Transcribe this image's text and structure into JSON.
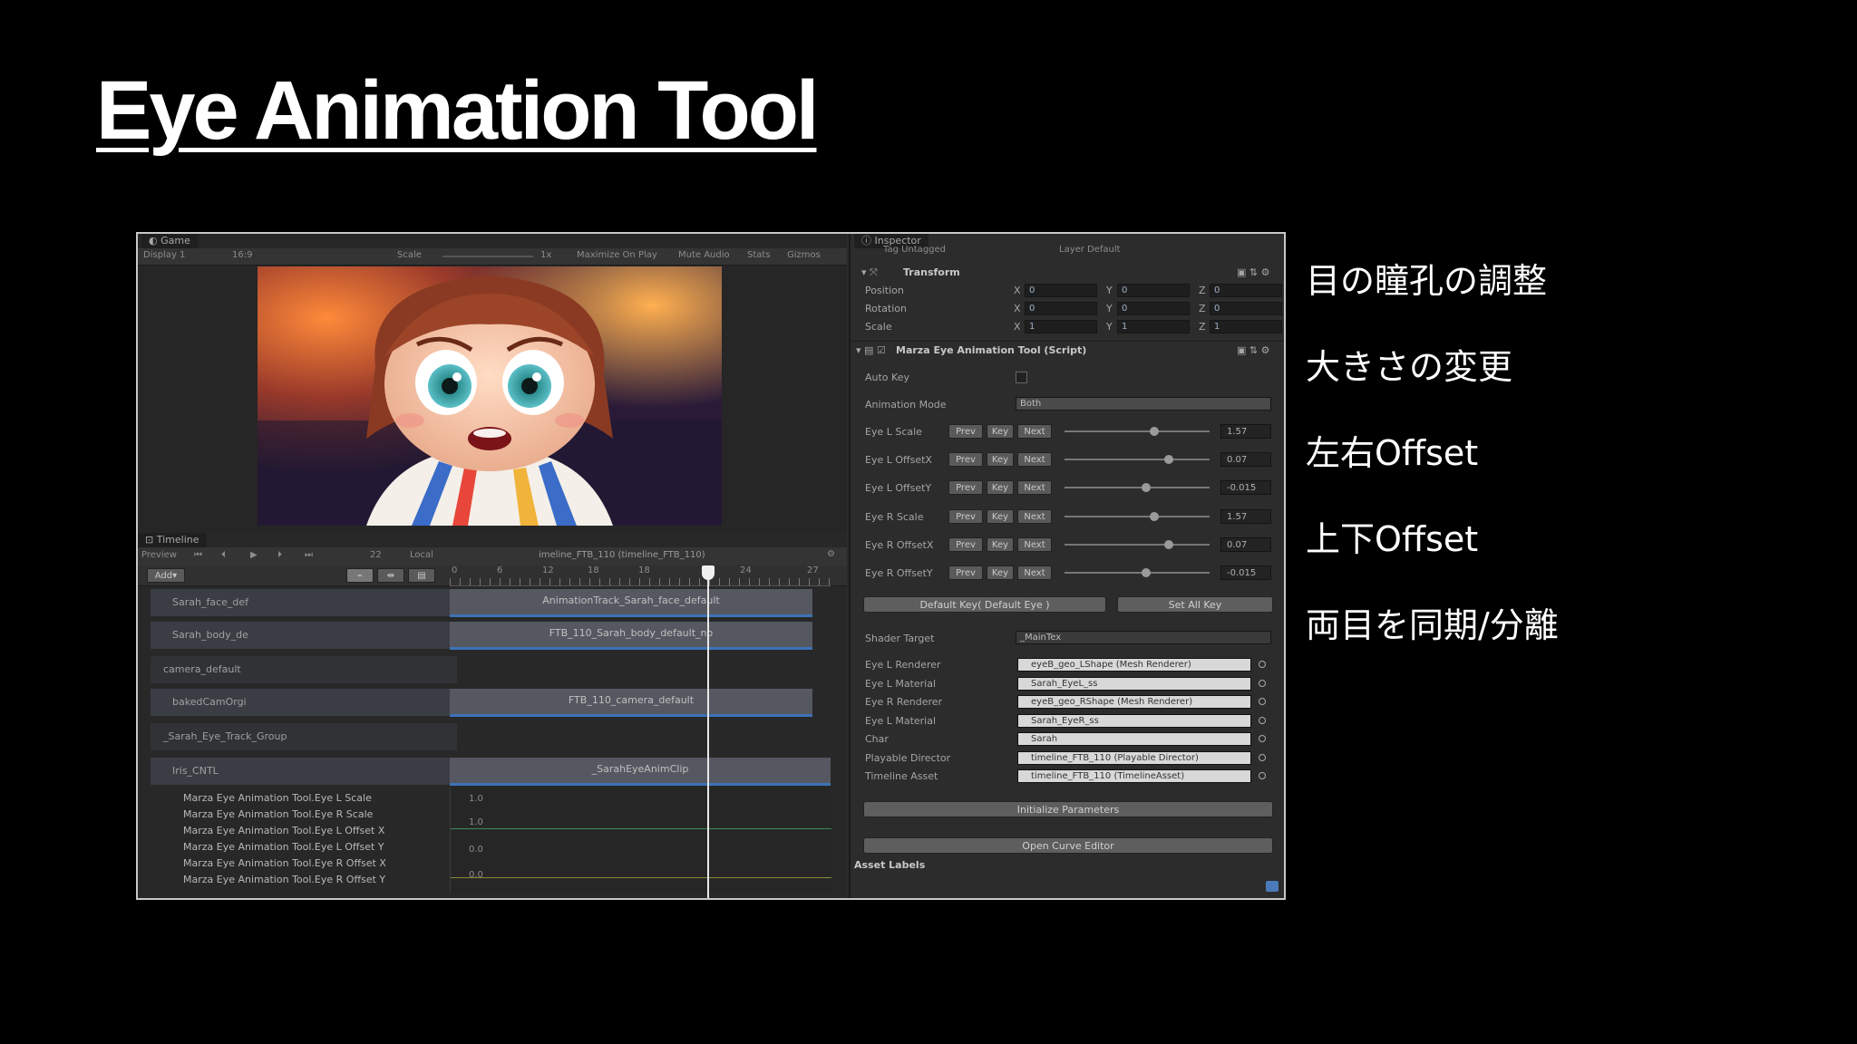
{
  "slide": {
    "title": "Eye Animation Tool",
    "bullets": [
      "目の瞳孔の調整",
      "大きさの変更",
      "左右Offset",
      "上下Offset",
      "両目を同期/分離"
    ]
  },
  "game": {
    "tab_label": "Game",
    "display": "Display 1",
    "aspect": "16:9",
    "scale_label": "Scale",
    "scale_value": "1x",
    "maximize": "Maximize On Play",
    "mute": "Mute Audio",
    "stats": "Stats",
    "gizmos": "Gizmos"
  },
  "timeline": {
    "tab_label": "Timeline",
    "preview_label": "Preview",
    "frame": "22",
    "local_label": "Local",
    "asset_name": "imeline_FTB_110 (timeline_FTB_110)",
    "add_label": "Add",
    "ruler_ticks": [
      "0",
      "6",
      "12",
      "18",
      "18",
      "24",
      "27"
    ],
    "tracks": [
      {
        "label": "Sarah_face_def",
        "clip": "AnimationTrack_Sarah_face_default"
      },
      {
        "label": "Sarah_body_de",
        "clip": "FTB_110_Sarah_body_default_no"
      },
      {
        "label": "camera_default",
        "clip": ""
      },
      {
        "label": "bakedCamOrgi",
        "clip": "FTB_110_camera_default"
      },
      {
        "label": "_Sarah_Eye_Track_Group",
        "clip": ""
      },
      {
        "label": "Iris_CNTL",
        "clip": "_SarahEyeAnimClip"
      }
    ],
    "properties": [
      "Marza Eye Animation Tool.Eye L Scale",
      "Marza Eye Animation Tool.Eye R Scale",
      "Marza Eye Animation Tool.Eye L Offset X",
      "Marza Eye Animation Tool.Eye L Offset Y",
      "Marza Eye Animation Tool.Eye R Offset X",
      "Marza Eye Animation Tool.Eye R Offset Y"
    ],
    "curve_values": [
      "1.0",
      "1.0",
      "0.0",
      "0.0"
    ]
  },
  "inspector": {
    "tab_label": "Inspector",
    "tag_row": "Tag  Untagged",
    "layer_row": "Layer  Default",
    "transform": {
      "title": "Transform",
      "rows": [
        {
          "label": "Position",
          "x": "0",
          "y": "0",
          "z": "0"
        },
        {
          "label": "Rotation",
          "x": "0",
          "y": "0",
          "z": "0"
        },
        {
          "label": "Scale",
          "x": "1",
          "y": "1",
          "z": "1"
        }
      ]
    },
    "script": {
      "title": "Marza Eye Animation Tool (Script)",
      "auto_key": "Auto Key",
      "anim_mode_label": "Animation Mode",
      "anim_mode_value": "Both",
      "buttons": {
        "prev": "Prev",
        "key": "Key",
        "next": "Next"
      },
      "params": [
        {
          "label": "Eye L Scale",
          "value": "1.57",
          "level": 0.62
        },
        {
          "label": "Eye L OffsetX",
          "value": "0.07",
          "level": 0.72
        },
        {
          "label": "Eye L OffsetY",
          "value": "-0.015",
          "level": 0.56
        },
        {
          "label": "Eye R Scale",
          "value": "1.57",
          "level": 0.62
        },
        {
          "label": "Eye R OffsetX",
          "value": "0.07",
          "level": 0.72
        },
        {
          "label": "Eye R OffsetY",
          "value": "-0.015",
          "level": 0.56
        }
      ],
      "default_key": "Default Key( Default Eye )",
      "set_all_key": "Set All Key",
      "shader_target_label": "Shader Target",
      "shader_target_value": "_MainTex",
      "refs": [
        {
          "label": "Eye L Renderer",
          "value": "eyeB_geo_LShape (Mesh Renderer)"
        },
        {
          "label": "Eye L Material",
          "value": "Sarah_EyeL_ss"
        },
        {
          "label": "Eye R Renderer",
          "value": "eyeB_geo_RShape (Mesh Renderer)"
        },
        {
          "label": "Eye L Material",
          "value": "Sarah_EyeR_ss"
        },
        {
          "label": "Char",
          "value": "Sarah"
        },
        {
          "label": "Playable Director",
          "value": "timeline_FTB_110 (Playable Director)"
        },
        {
          "label": "Timeline Asset",
          "value": "timeline_FTB_110 (TimelineAsset)"
        }
      ],
      "init_params": "Initialize Parameters",
      "open_curve": "Open Curve Editor",
      "asset_labels": "Asset Labels"
    }
  },
  "colors": {
    "background": "#000000",
    "panel": "#2b2b2b",
    "clip_accent": "#3c72b8"
  }
}
